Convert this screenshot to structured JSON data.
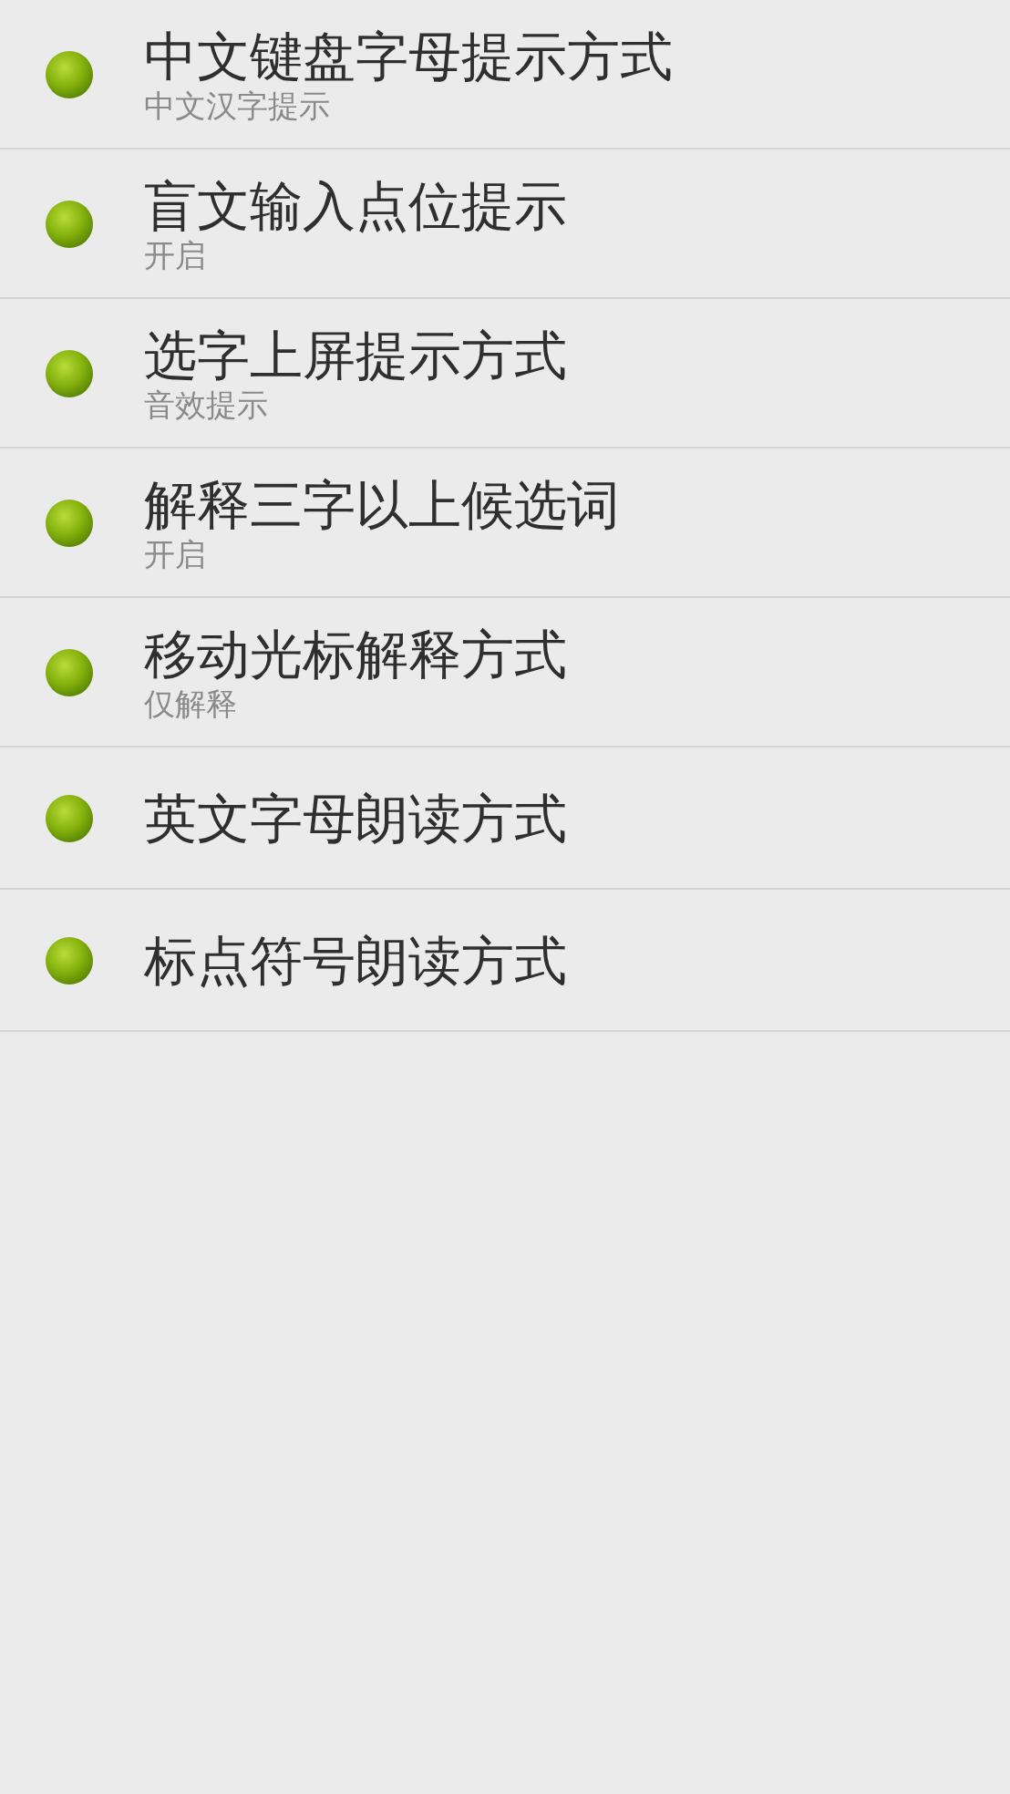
{
  "settings": [
    {
      "title": "中文键盘字母提示方式",
      "summary": "中文汉字提示"
    },
    {
      "title": "盲文输入点位提示",
      "summary": "开启"
    },
    {
      "title": "选字上屏提示方式",
      "summary": "音效提示"
    },
    {
      "title": "解释三字以上候选词",
      "summary": "开启"
    },
    {
      "title": "移动光标解释方式",
      "summary": "仅解释"
    },
    {
      "title": "英文字母朗读方式"
    },
    {
      "title": "标点符号朗读方式"
    }
  ]
}
